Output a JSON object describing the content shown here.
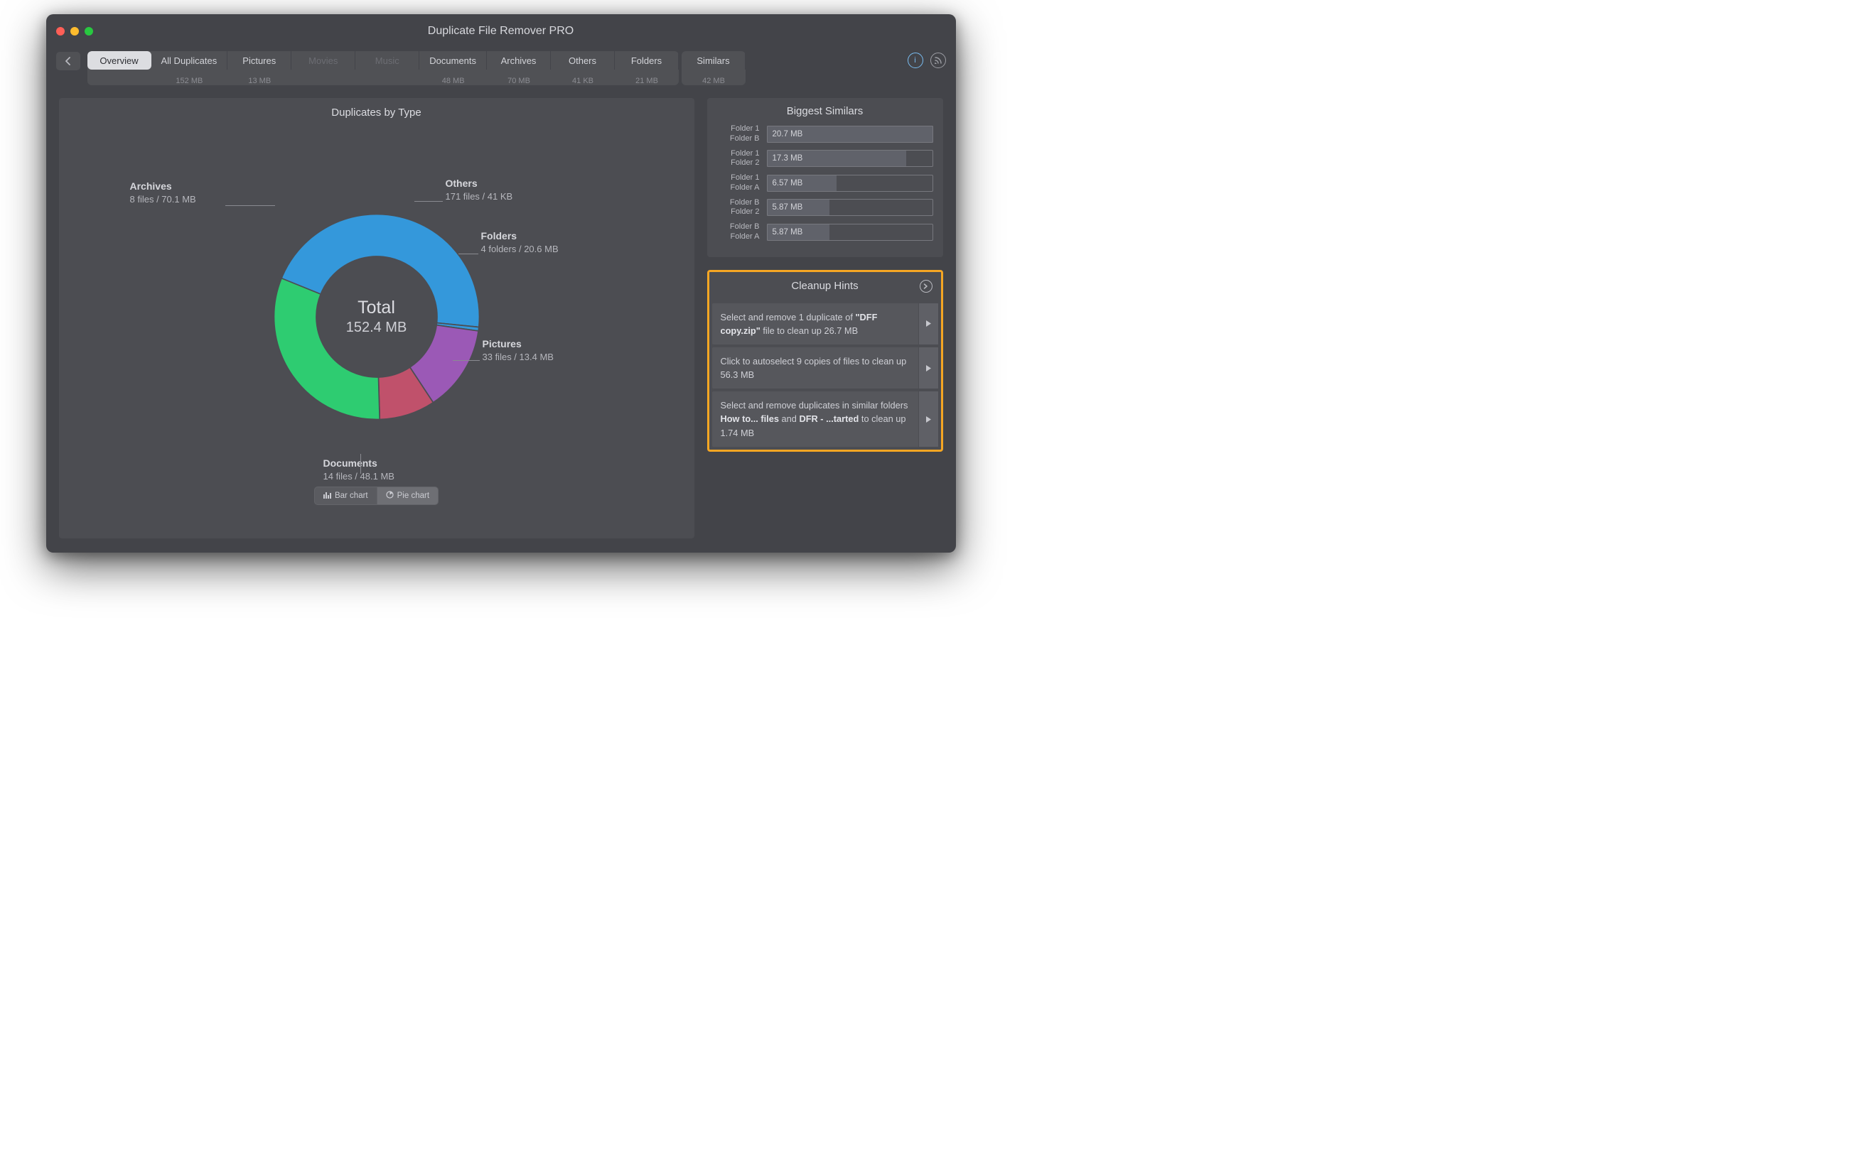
{
  "window": {
    "title": "Duplicate File Remover PRO"
  },
  "tabs": [
    {
      "label": "Overview",
      "size": "",
      "active": true,
      "dim": false
    },
    {
      "label": "All Duplicates",
      "size": "152 MB",
      "active": false,
      "dim": false
    },
    {
      "label": "Pictures",
      "size": "13 MB",
      "active": false,
      "dim": false
    },
    {
      "label": "Movies",
      "size": "",
      "active": false,
      "dim": true
    },
    {
      "label": "Music",
      "size": "",
      "active": false,
      "dim": true
    },
    {
      "label": "Documents",
      "size": "48 MB",
      "active": false,
      "dim": false
    },
    {
      "label": "Archives",
      "size": "70 MB",
      "active": false,
      "dim": false
    },
    {
      "label": "Others",
      "size": "41 KB",
      "active": false,
      "dim": false
    },
    {
      "label": "Folders",
      "size": "21 MB",
      "active": false,
      "dim": false
    },
    {
      "label": "Similars",
      "size": "42 MB",
      "active": false,
      "dim": false
    }
  ],
  "chart": {
    "title": "Duplicates by Type",
    "total_label": "Total",
    "total_value": "152.4 MB",
    "toggle": {
      "bar": "Bar chart",
      "pie": "Pie chart",
      "active": "pie"
    },
    "segments": [
      {
        "title": "Archives",
        "value": "8 files / 70.1 MB",
        "color": "#3498db",
        "pos": "tl"
      },
      {
        "title": "Others",
        "value": "171 files / 41 KB",
        "color": "#3498db",
        "pos": "tr1"
      },
      {
        "title": "Folders",
        "value": "4 folders / 20.6 MB",
        "color": "#9b59b6",
        "pos": "tr2"
      },
      {
        "title": "Pictures",
        "value": "33 files / 13.4 MB",
        "color": "#c0516b",
        "pos": "r"
      },
      {
        "title": "Documents",
        "value": "14 files / 48.1 MB",
        "color": "#2ecc71",
        "pos": "b"
      }
    ]
  },
  "chart_data": {
    "type": "pie",
    "title": "Duplicates by Type",
    "total": "152.4 MB",
    "series": [
      {
        "name": "Archives",
        "size_mb": 70.1,
        "count_label": "8 files",
        "color": "#3498db"
      },
      {
        "name": "Documents",
        "size_mb": 48.1,
        "count_label": "14 files",
        "color": "#2ecc71"
      },
      {
        "name": "Folders",
        "size_mb": 20.6,
        "count_label": "4 folders",
        "color": "#9b59b6"
      },
      {
        "name": "Pictures",
        "size_mb": 13.4,
        "count_label": "33 files",
        "color": "#c0516b"
      },
      {
        "name": "Others",
        "size_mb": 0.041,
        "count_label": "171 files",
        "color": "#3498db"
      }
    ]
  },
  "similars": {
    "title": "Biggest Similars",
    "rows": [
      {
        "a": "Folder 1",
        "b": "Folder B",
        "size": "20.7 MB",
        "pct": 100
      },
      {
        "a": "Folder 1",
        "b": "Folder 2",
        "size": "17.3 MB",
        "pct": 84
      },
      {
        "a": "Folder 1",
        "b": "Folder A",
        "size": "6.57 MB",
        "pct": 42
      },
      {
        "a": "Folder B",
        "b": "Folder 2",
        "size": "5.87 MB",
        "pct": 38
      },
      {
        "a": "Folder B",
        "b": "Folder A",
        "size": "5.87 MB",
        "pct": 38
      }
    ]
  },
  "hints": {
    "title": "Cleanup Hints",
    "items": [
      {
        "pre": "Select and remove 1 duplicate of ",
        "bold": "\"DFF copy.zip\"",
        "post": " file to clean up 26.7 MB"
      },
      {
        "pre": "Click to autoselect 9 copies of files to clean up 56.3 MB",
        "bold": "",
        "post": ""
      },
      {
        "pre": "Select and remove duplicates in similar folders ",
        "bold": "How to... files",
        "mid": " and ",
        "bold2": "DFR - ...tarted",
        "post": " to clean up 1.74 MB"
      }
    ]
  }
}
